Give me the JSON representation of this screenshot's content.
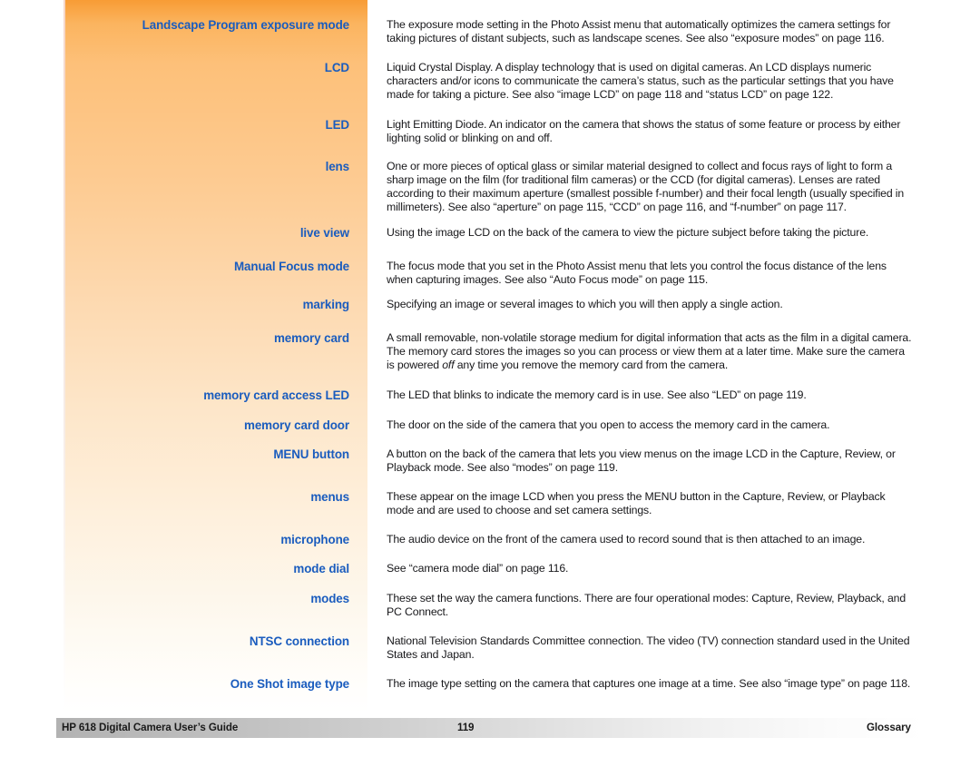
{
  "page": {
    "title": "Glossary",
    "accent_orange_top": "#f89c35",
    "term_color": "#1a5cbe",
    "body_color": "#17171a"
  },
  "entries": [
    {
      "term": "Landscape Program exposure mode",
      "definition": "The exposure mode setting in the Photo Assist menu that automatically optimizes the camera settings for taking pictures of distant subjects, such as landscape scenes. See also “exposure modes” on page 116."
    },
    {
      "term": "LCD",
      "definition": "Liquid Crystal Display. A display technology that is used on digital cameras. An LCD displays numeric characters and/or icons to communicate the camera’s status, such as the particular settings that you have made for taking a picture. See also “image LCD” on page 118 and “status LCD” on page 122."
    },
    {
      "term": "LED",
      "definition": "Light Emitting Diode. An indicator on the camera that shows the status of some feature or process by either lighting solid or blinking on and off."
    },
    {
      "term": "lens",
      "definition": "One or more pieces of optical glass or similar material designed to collect and focus rays of light to form a sharp image on the film (for traditional film cameras) or the CCD (for digital cameras). Lenses are rated according to their maximum aperture (smallest possible f-number) and their focal length (usually specified in millimeters). See also “aperture” on page 115, “CCD” on page 116, and “f-number” on page 117."
    },
    {
      "term": "live view",
      "definition": "Using the image LCD on the back of the camera to view the picture subject before taking the picture."
    },
    {
      "term": "Manual Focus mode",
      "definition": "The focus mode that you set in the Photo Assist menu that lets you control the focus distance of the lens when capturing images. See also “Auto Focus mode” on page 115."
    },
    {
      "term": "marking",
      "definition": "Specifying an image or several images to which you will then apply a single action."
    },
    {
      "term": "memory card",
      "definition_parts": [
        "A small removable, non-volatile storage medium for digital information that acts as the film in a digital camera. The memory card stores the images so you can process or view them at a later time. Make sure the camera is powered ",
        "off",
        " any time you remove the memory card from the camera."
      ],
      "definition": "A small removable, non-volatile storage medium for digital information that acts as the film in a digital camera. The memory card stores the images so you can process or view them at a later time. Make sure the camera is powered off any time you remove the memory card from the camera."
    },
    {
      "term": "memory card access LED",
      "definition": "The LED that blinks to indicate the memory card is in use. See also “LED” on page 119."
    },
    {
      "term": "memory card door",
      "definition": "The door on the side of the camera that you open to access the memory card in the camera."
    },
    {
      "term": "MENU button",
      "definition": "A button on the back of the camera that lets you view menus on the image LCD in the Capture, Review, or Playback mode. See also “modes” on page 119."
    },
    {
      "term": "menus",
      "definition": "These appear on the image LCD when you press the MENU button in the Capture, Review, or Playback mode and are used to choose and set camera settings."
    },
    {
      "term": "microphone",
      "definition": "The audio device on the front of the camera used to record sound that is then attached to an image."
    },
    {
      "term": "mode dial",
      "definition": "See “camera mode dial” on page 116."
    },
    {
      "term": "modes",
      "definition": "These set the way the camera functions. There are four operational modes: Capture, Review, Playback, and PC Connect."
    },
    {
      "term": "NTSC connection",
      "definition": "National Television Standards Committee connection. The video (TV) connection standard used in the United States and Japan."
    },
    {
      "term": "One Shot image type",
      "definition": "The image type setting on the camera that captures one image at a time. See also “image type” on page 118."
    }
  ],
  "footer": {
    "left": "HP 618 Digital Camera User’s Guide",
    "page_number": "119",
    "right": "Glossary"
  }
}
